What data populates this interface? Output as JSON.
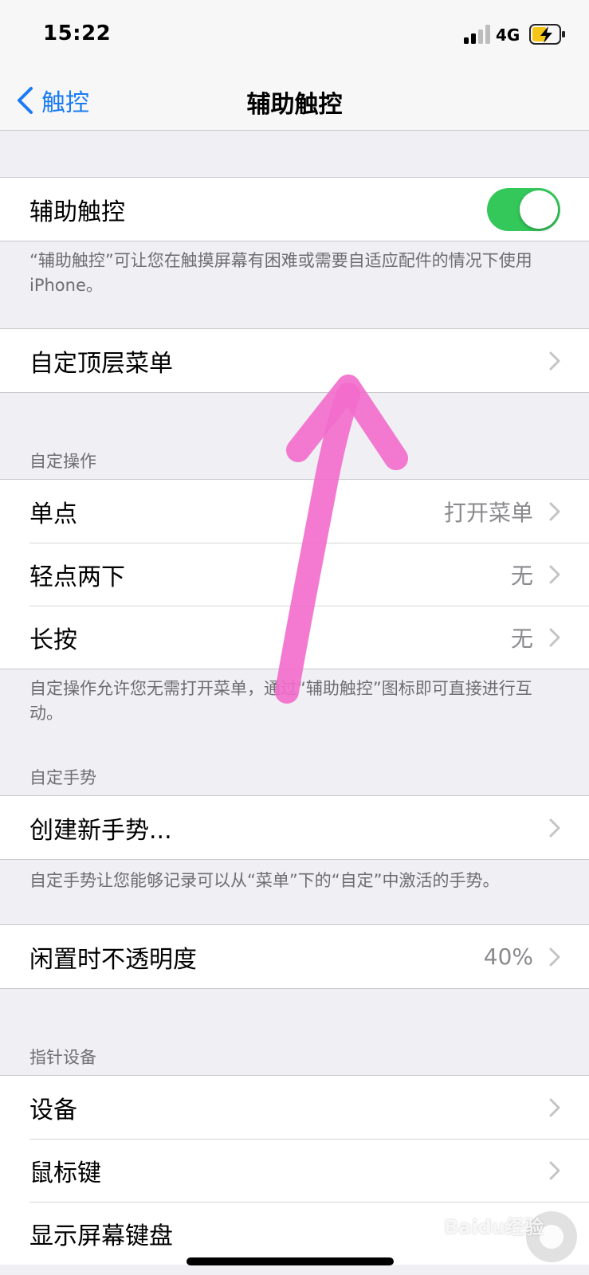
{
  "status_bar": {
    "time": "15:22",
    "network": "4G"
  },
  "nav": {
    "back_label": "触控",
    "title": "辅助触控"
  },
  "assistive_touch": {
    "label": "辅助触控",
    "enabled": true,
    "footer": "“辅助触控”可让您在触摸屏幕有困难或需要自适应配件的情况下使用iPhone。"
  },
  "top_menu": {
    "label": "自定顶层菜单"
  },
  "custom_actions": {
    "header": "自定操作",
    "rows": [
      {
        "label": "单点",
        "value": "打开菜单"
      },
      {
        "label": "轻点两下",
        "value": "无"
      },
      {
        "label": "长按",
        "value": "无"
      }
    ],
    "footer": "自定操作允许您无需打开菜单，通过“辅助触控”图标即可直接进行互动。"
  },
  "custom_gestures": {
    "header": "自定手势",
    "create_label": "创建新手势...",
    "footer": "自定手势让您能够记录可以从“菜单”下的“自定”中激活的手势。"
  },
  "idle_opacity": {
    "label": "闲置时不透明度",
    "value": "40%"
  },
  "pointer_devices": {
    "header": "指针设备",
    "rows": [
      {
        "label": "设备"
      },
      {
        "label": "鼠标键"
      },
      {
        "label": "显示屏幕键盘"
      }
    ]
  },
  "watermark": "Baidu经验",
  "colors": {
    "accent": "#1a7bf5",
    "toggle_on": "#34c759",
    "annotation": "#f26ccb"
  }
}
